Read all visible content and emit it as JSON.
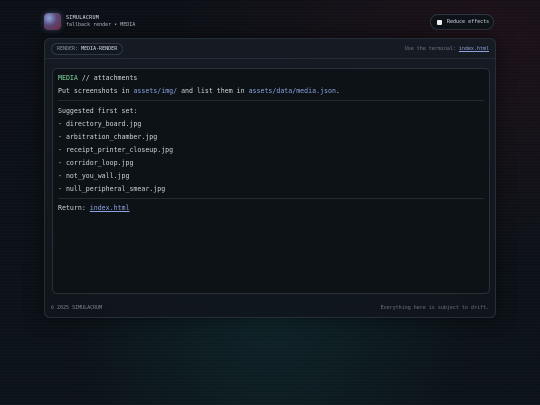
{
  "brand": {
    "name": "SIMULACRUM",
    "subtitle": "fallback render • MEDIA"
  },
  "controls": {
    "reduce_effects_label": "Reduce effects",
    "reduce_effects_checked": false
  },
  "panel": {
    "render_label": "RENDER:",
    "render_value": "MEDIA-RENDER",
    "terminal_hint": "Use the terminal:",
    "terminal_link": "index.html"
  },
  "media": {
    "heading_tag": "MEDIA",
    "heading_rest": " // attachments",
    "instr_1": "Put screenshots in ",
    "instr_path_1": "assets/img/",
    "instr_2": " and list them in ",
    "instr_path_2": "assets/data/media.json",
    "instr_3": ".",
    "suggested_label": "Suggested first set:",
    "files": [
      "- directory_board.jpg",
      "- arbitration_chamber.jpg",
      "- receipt_printer_closeup.jpg",
      "- corridor_loop.jpg",
      "- not_you_wall.jpg",
      "- null_peripheral_smear.jpg"
    ],
    "return_label": "Return: ",
    "return_link": "index.html"
  },
  "footer": {
    "copyright": "© 2025 SIMULACRUM",
    "tagline": "Everything here is subject to drift."
  },
  "colors": {
    "accent_green": "#7fd39a",
    "link_blue": "#8aa3e0",
    "background": "#0c1016"
  }
}
